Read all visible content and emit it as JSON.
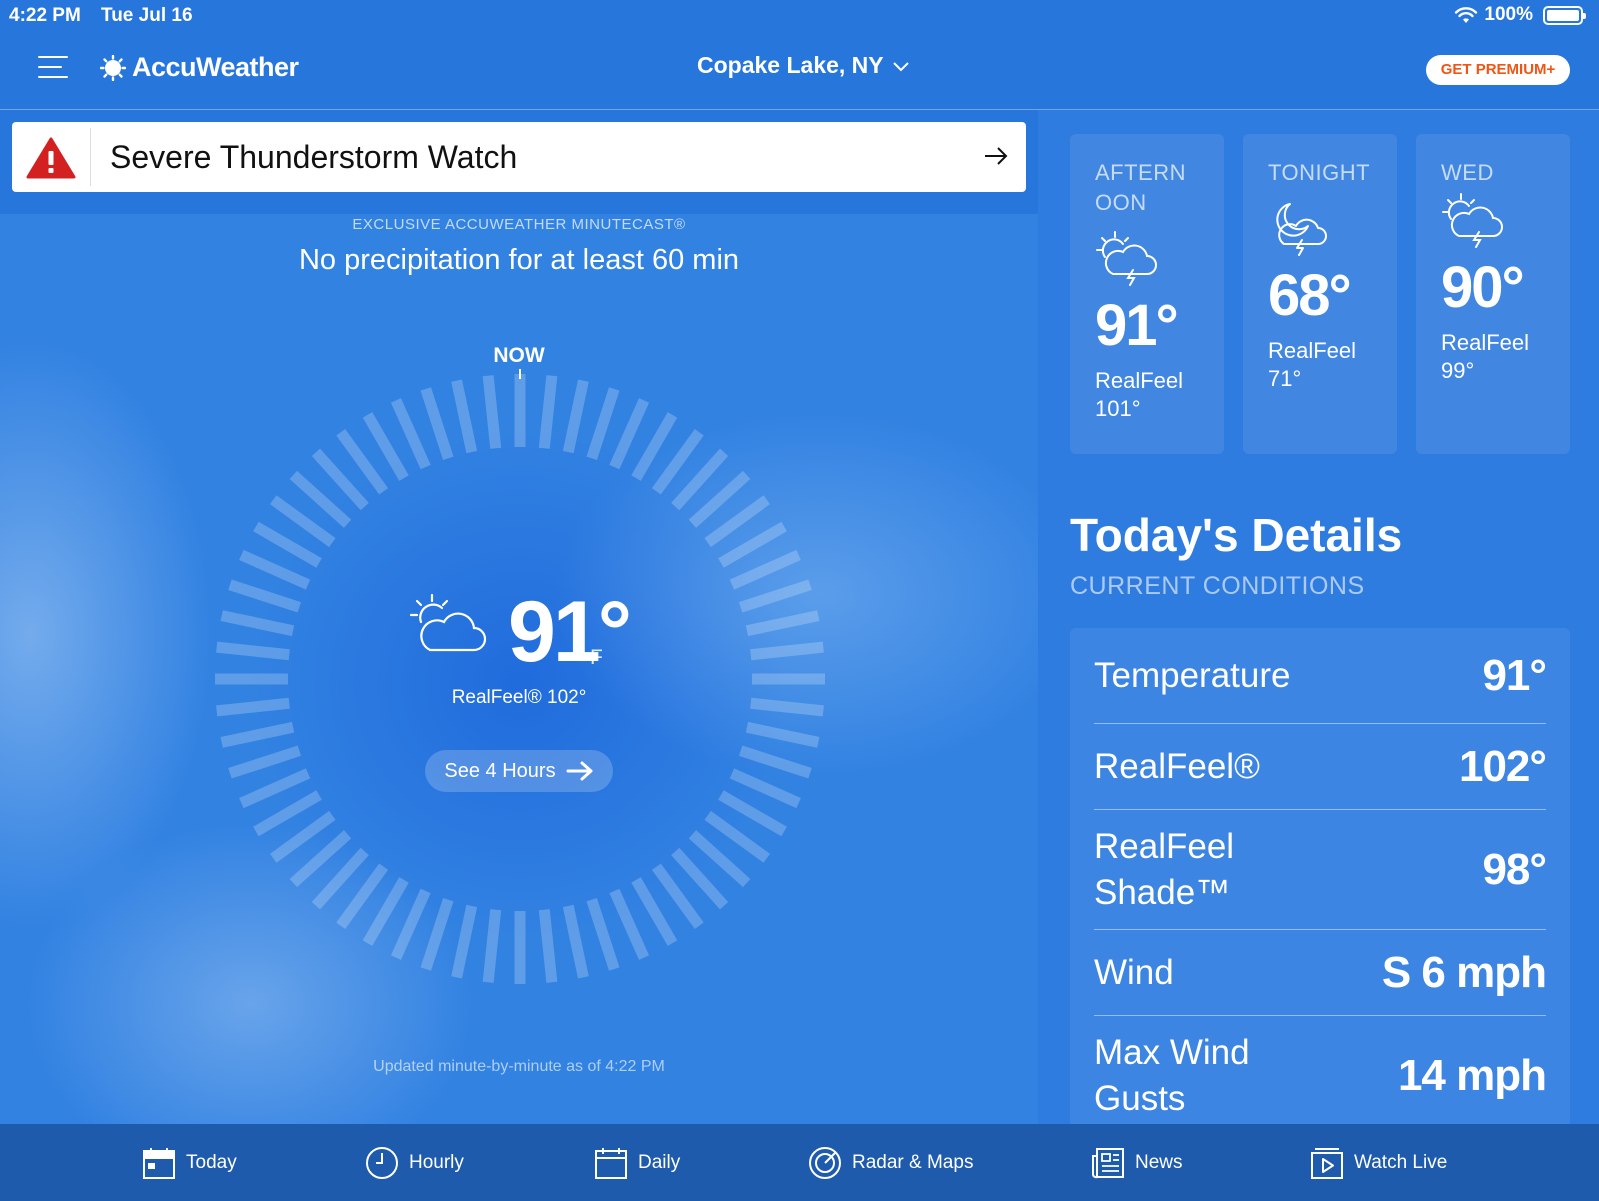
{
  "status_bar": {
    "time": "4:22 PM",
    "date": "Tue Jul 16",
    "battery": "100%"
  },
  "header": {
    "app_name": "AccuWeather",
    "location": "Copake Lake, NY",
    "premium_label": "GET PREMIUM+"
  },
  "alert": {
    "title": "Severe Thunderstorm Watch"
  },
  "minutecast": {
    "label": "EXCLUSIVE ACCUWEATHER MINUTECAST®",
    "text": "No precipitation for at least 60 min",
    "now_label": "NOW",
    "updated": "Updated minute-by-minute as of 4:22 PM"
  },
  "current": {
    "temp": "91°",
    "unit": "F",
    "realfeel": "RealFeel® 102°",
    "see_hours": "See 4 Hours",
    "icon": "partly-sunny-icon"
  },
  "forecast": [
    {
      "period": "AFTERNOON",
      "temp": "91°",
      "realfeel_label": "RealFeel",
      "realfeel_value": "101°",
      "icon": "sun-storm-icon"
    },
    {
      "period": "TONIGHT",
      "temp": "68°",
      "realfeel_label": "RealFeel",
      "realfeel_value": "71°",
      "icon": "moon-storm-icon"
    },
    {
      "period": "WED",
      "temp": "90°",
      "realfeel_label": "RealFeel",
      "realfeel_value": "99°",
      "icon": "sun-storm-icon"
    }
  ],
  "details": {
    "title": "Today's Details",
    "subtitle": "CURRENT CONDITIONS",
    "rows": [
      {
        "label": "Temperature",
        "value": "91°"
      },
      {
        "label": "RealFeel®",
        "value": "102°"
      },
      {
        "label": "RealFeel Shade™",
        "value": "98°"
      },
      {
        "label": "Wind",
        "value": "S 6 mph"
      },
      {
        "label": "Max Wind Gusts",
        "value": "14 mph"
      }
    ]
  },
  "nav": [
    {
      "label": "Today",
      "icon": "calendar-today-icon"
    },
    {
      "label": "Hourly",
      "icon": "clock-icon"
    },
    {
      "label": "Daily",
      "icon": "calendar-icon"
    },
    {
      "label": "Radar & Maps",
      "icon": "radar-icon"
    },
    {
      "label": "News",
      "icon": "newspaper-icon"
    },
    {
      "label": "Watch Live",
      "icon": "play-icon"
    }
  ],
  "colors": {
    "background": "#2776dc",
    "nav_bar": "#1e5bac",
    "alert_red": "#d32121",
    "premium_text": "#f05514"
  }
}
